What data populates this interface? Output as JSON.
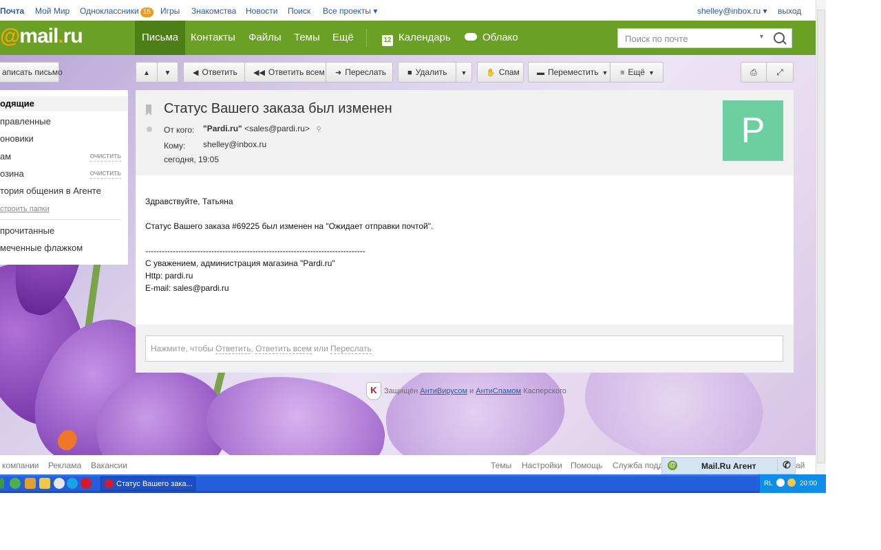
{
  "portal": {
    "items": [
      "Почта",
      "Мой Мир",
      "Одноклассники",
      "Игры",
      "Знакомства",
      "Новости",
      "Поиск",
      "Все проекты ▾"
    ],
    "ok_badge": "15",
    "user": "shelley@inbox.ru ▾",
    "logout": "выход"
  },
  "header": {
    "logo_at": "@",
    "logo_text": "mail",
    "logo_dot": ".",
    "logo_ru": "ru",
    "nav": [
      "Письма",
      "Контакты",
      "Файлы",
      "Темы",
      "Ещё"
    ],
    "calendar_num": "12",
    "calendar": "Календарь",
    "cloud": "Облако",
    "search_placeholder": "Поиск по почте"
  },
  "toolbar": {
    "compose": "аписать письмо",
    "reply": "Ответить",
    "reply_all": "Ответить всем",
    "forward": "Переслать",
    "delete": "Удалить",
    "spam": "Спам",
    "move": "Переместить",
    "more": "Ещё"
  },
  "folders": {
    "items": [
      "одящие",
      "правленные",
      "оновики",
      "ам",
      "озина",
      "тория общения в Агенте"
    ],
    "clear": "очистить",
    "setup": "строить папки",
    "unread": "прочитанные",
    "flagged": "меченные флажком"
  },
  "message": {
    "subject": "Статус Вашего заказа был изменен",
    "from_label": "От кого:",
    "from_name": "\"Pardi.ru\"",
    "from_email": "<sales@pardi.ru>",
    "to_label": "Кому:",
    "to": "shelley@inbox.ru",
    "date": "сегодня, 19:05",
    "avatar": "P",
    "body": [
      "Здравствуйте, Татьяна",
      "",
      "Статус Вашего заказа #69225 был изменен на \"Ожидает отправки почтой\".",
      "",
      "",
      "--------------------------------------------------------------------------------",
      "С уважением, администрация магазина \"Pardi.ru\"",
      "Http: pardi.ru",
      "E-mail: sales@pardi.ru"
    ],
    "reply_prefix": "Нажмите, чтобы ",
    "reply_link": "Ответить",
    "reply_comma": ", ",
    "reply_all_link": "Ответить всем",
    "reply_or": " или ",
    "forward_link": "Переслать"
  },
  "protection": {
    "prefix": "Защищён ",
    "antivirus": "АнтиВирусом",
    "and": " и ",
    "antispam": "АнтиСпамом",
    "suffix": " Касперского"
  },
  "footer": {
    "left": [
      "компании",
      "Реклама",
      "Вакансии"
    ],
    "right": [
      "Темы",
      "Настройки",
      "Помощь",
      "Служба подд"
    ],
    "tail": "ай"
  },
  "agent": {
    "title": "Mail.Ru Агент"
  },
  "taskbar": {
    "task": "Статус Вашего зака...",
    "lang": "RL",
    "time": "20:00"
  }
}
